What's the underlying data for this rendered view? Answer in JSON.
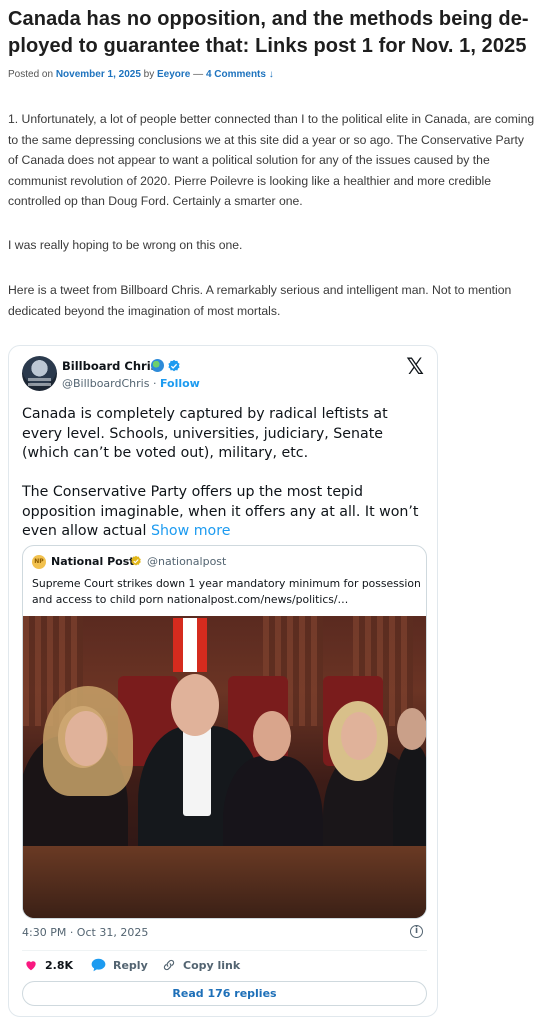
{
  "post": {
    "title": "Canada has no opposition, and the methods being de-ployed to guarantee that: Links post 1 for Nov. 1, 2025",
    "title_line1": "Canada has no opposition, and the methods being de-",
    "title_line2": "ployed to guarantee that: Links post 1 for Nov. 1, 2025",
    "meta": {
      "posted_on": "Posted on",
      "date": "November 1, 2025",
      "by": "by",
      "author": "Eeyore",
      "separator": "—",
      "comments": "4 Comments ↓"
    },
    "paragraphs": [
      "1. Unfortunately, a lot of people better connected than I to the political elite in Canada, are coming to the same depressing conclusions we at this site did a year or so ago. The Conservative Party of Canada does not appear to want a political solution for any of the issues caused by the communist revolution of 2020. Pierre Poilevre is looking like a healthier and more credible controlled op than Doug Ford. Certainly a smarter one.",
      "I was really hoping to be wrong on this one.",
      "Here is a tweet from Billboard Chris. A remarkably serious and intelligent man. Not to mention dedicated beyond the imagination of most mortals."
    ]
  },
  "tweet": {
    "author_name": "Billboard Chris",
    "handle": "@BillboardChris",
    "dot": "·",
    "follow": "Follow",
    "logo": "𝕏",
    "text_p1": "Canada is completely captured by radical leftists at every level. Schools, universities, judiciary, Senate (which can’t be voted out), military, etc.",
    "text_p2": "The Conservative Party offers up the most tepid opposition imaginable, when it offers any at all. It won’t even allow actual",
    "show_more": "Show more",
    "quote": {
      "logo_text": "NP",
      "name": "National Post",
      "handle": "@nationalpost",
      "text": "Supreme Court strikes down 1 year mandatory minimum for possession and access to child porn nationalpost.com/news/politics/…"
    },
    "timestamp": "4:30 PM · Oct 31, 2025",
    "info": "i",
    "likes": "2.8K",
    "reply_label": "Reply",
    "copy_link_label": "Copy link",
    "read_replies": "Read 176 replies",
    "colors": {
      "accent": "#1d9bf0",
      "heart": "#f91880",
      "text": "#0f1419",
      "muted": "#536471"
    }
  }
}
